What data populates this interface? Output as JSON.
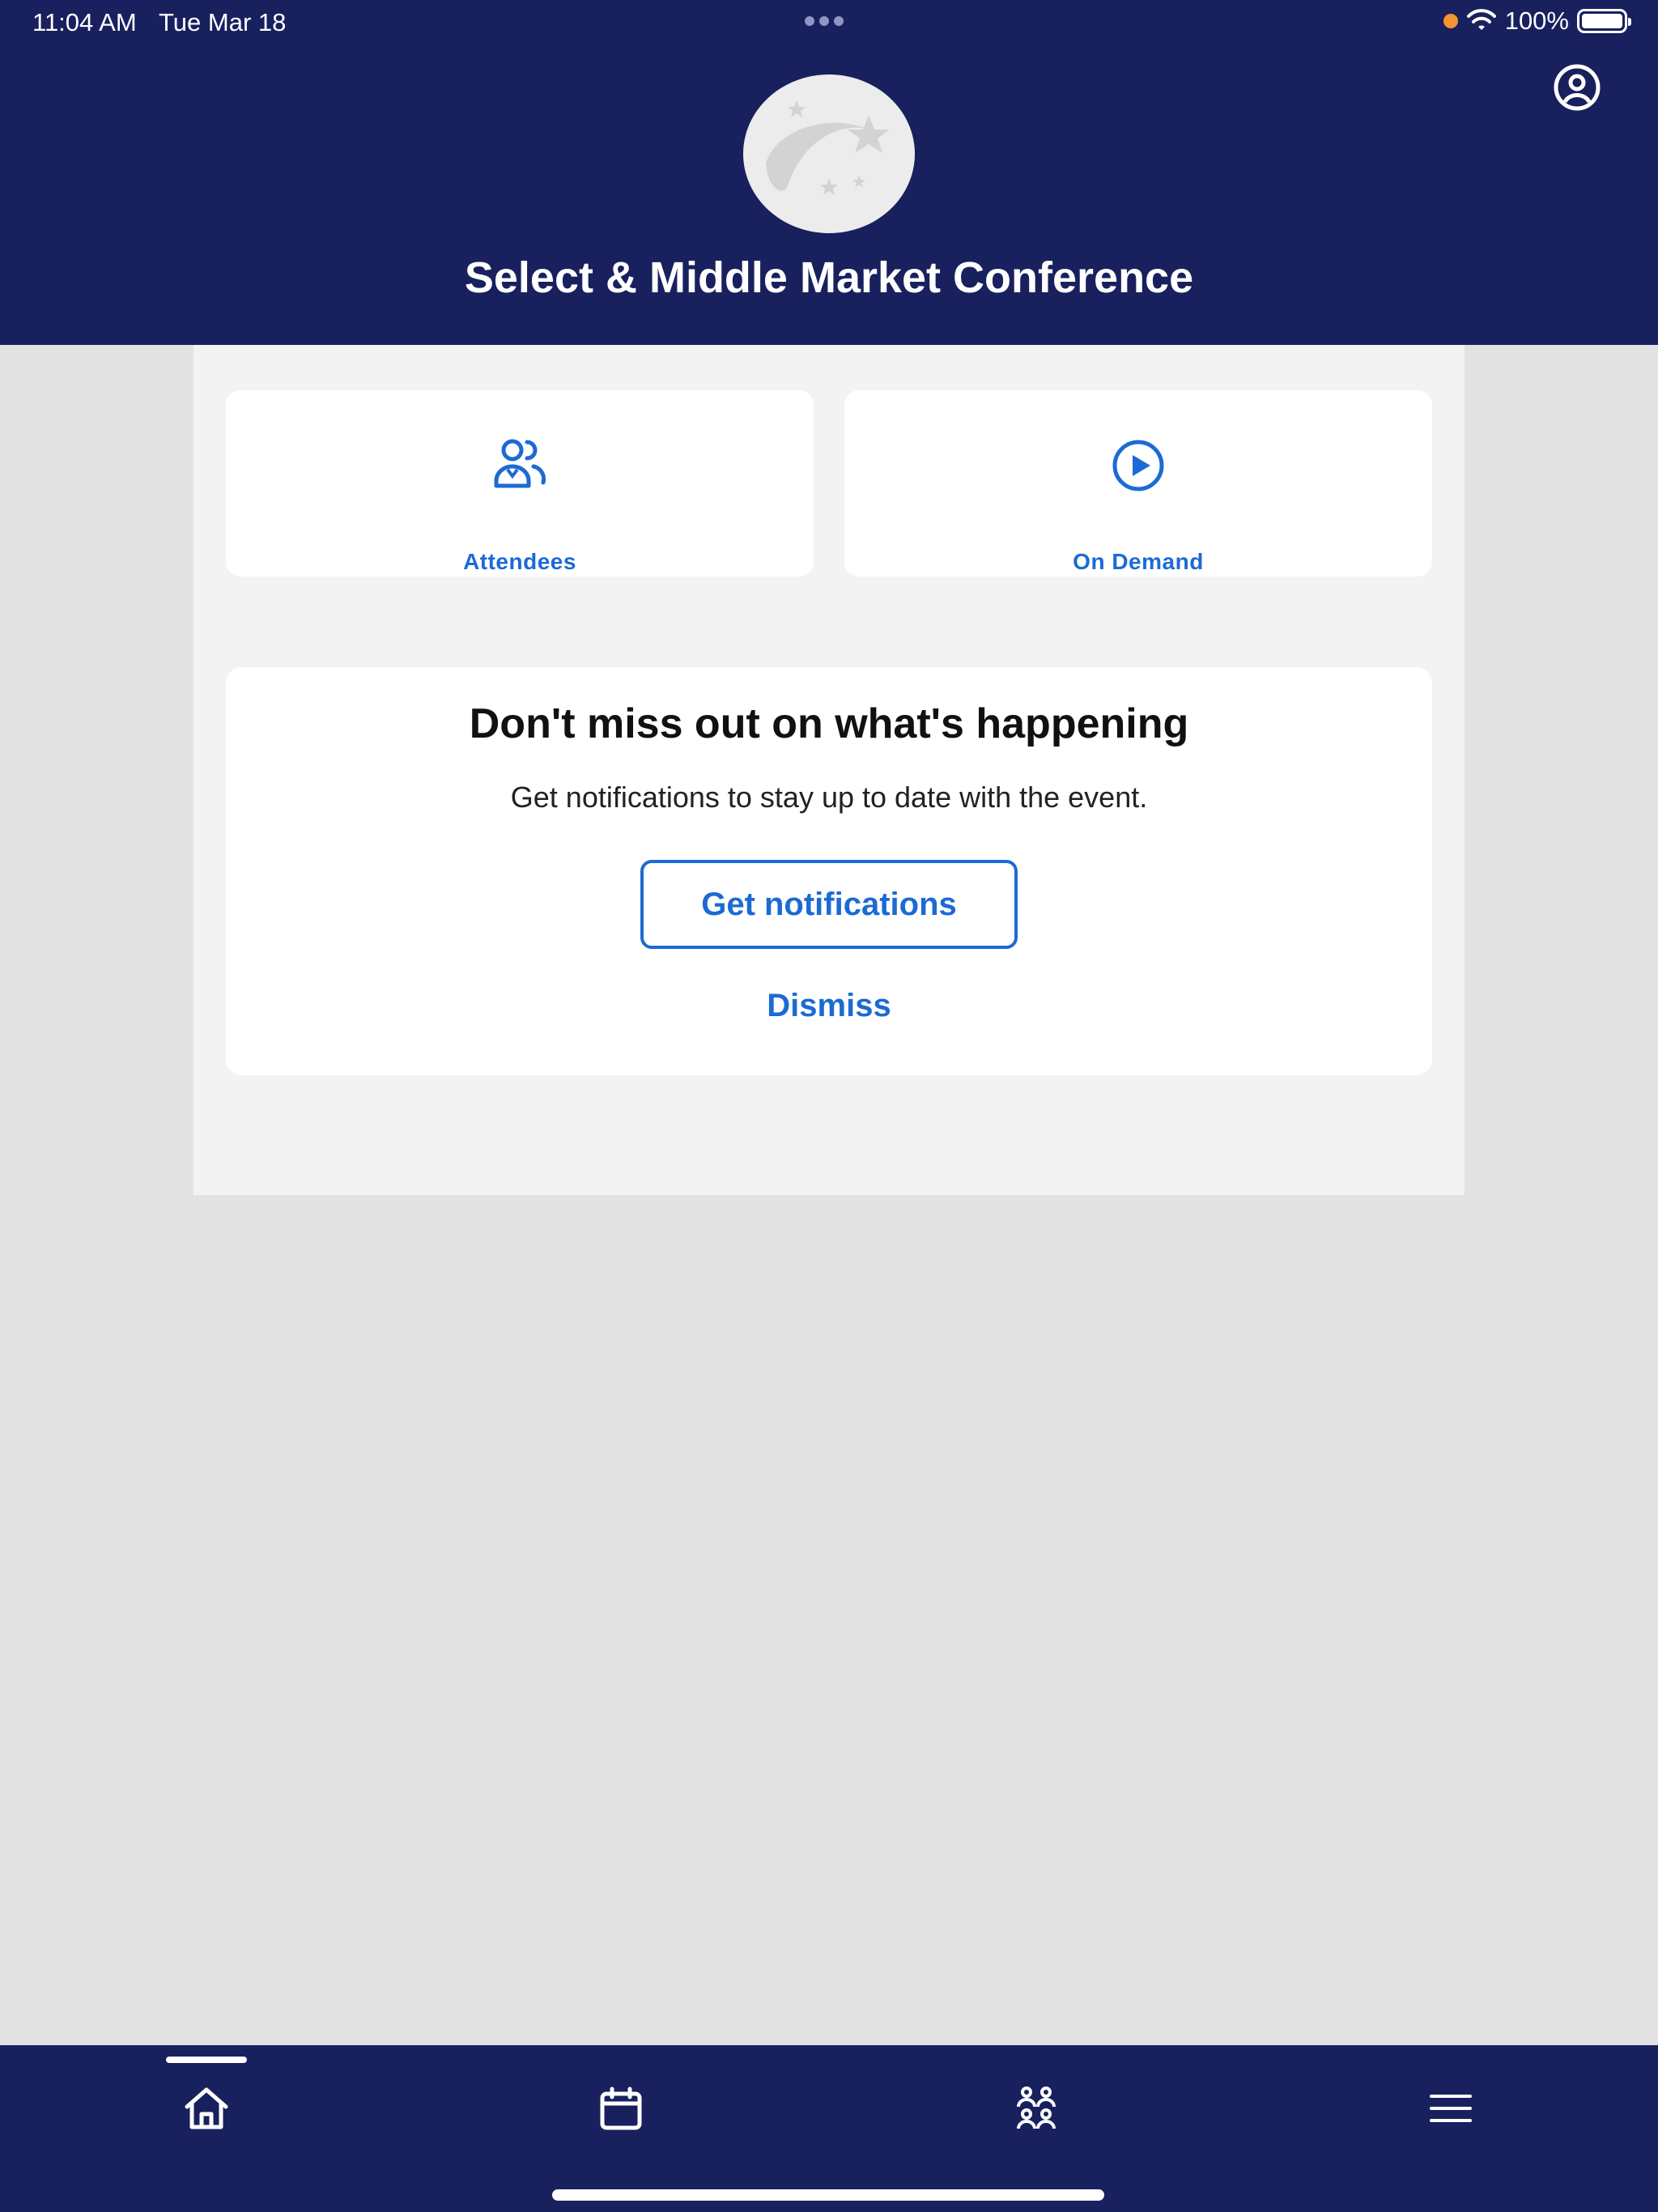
{
  "status_bar": {
    "time": "11:04 AM",
    "date": "Tue Mar 18",
    "battery": "100%"
  },
  "header": {
    "title": "Select & Middle Market Conference"
  },
  "quick_links": [
    {
      "label": "Attendees",
      "icon": "attendees-icon"
    },
    {
      "label": "On Demand",
      "icon": "play-circle-icon"
    }
  ],
  "notification_prompt": {
    "title": "Don't miss out on what's happening",
    "subtitle": "Get notifications to stay up to date with the event.",
    "primary_button": "Get notifications",
    "secondary_link": "Dismiss"
  },
  "tab_bar": {
    "tabs": [
      {
        "icon": "home-icon",
        "selected": true
      },
      {
        "icon": "calendar-icon",
        "selected": false
      },
      {
        "icon": "people-group-icon",
        "selected": false
      },
      {
        "icon": "hamburger-menu-icon",
        "selected": false
      }
    ]
  },
  "colors": {
    "header_bg": "#18205e",
    "accent": "#1c6ad4",
    "page_bg": "#e2e2e2",
    "panel_bg": "#f3f3f3",
    "recording_dot": "#f2952f"
  }
}
